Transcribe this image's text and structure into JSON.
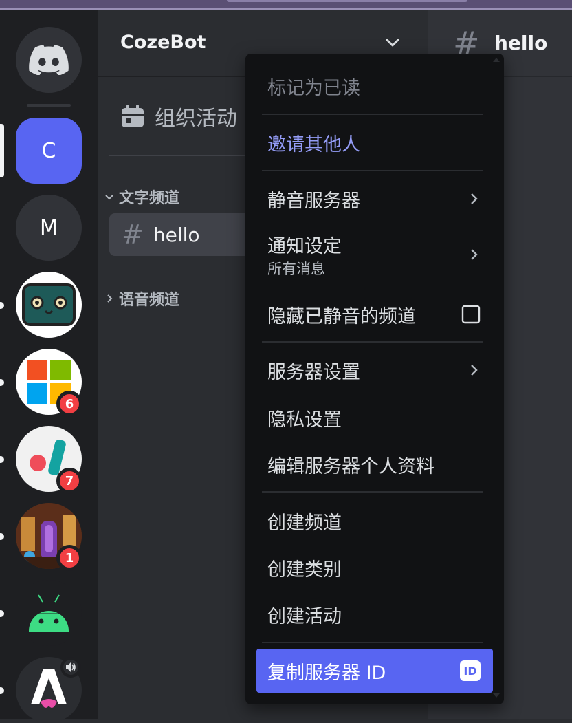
{
  "guild": {
    "name": "CozeBot"
  },
  "sidebar": {
    "events_label": "组织活动",
    "categories": [
      {
        "label": "文字频道",
        "expanded": true
      },
      {
        "label": "语音频道",
        "expanded": false
      }
    ],
    "channel": {
      "hash": "#",
      "name": "hello"
    }
  },
  "chat": {
    "hash": "#",
    "title": "hello"
  },
  "servers": [
    {
      "letter": "C",
      "color": "#5865f2",
      "selected": true
    },
    {
      "letter": "M",
      "color": "#313338"
    },
    {
      "badge": ""
    },
    {
      "badge": "6"
    },
    {
      "badge": "7"
    },
    {
      "badge": "1"
    },
    {
      "badge": ""
    },
    {
      "badge": ""
    }
  ],
  "menu": {
    "mark_read": "标记为已读",
    "invite": "邀请其他人",
    "mute_server": "静音服务器",
    "notification_settings": "通知设定",
    "notification_value": "所有消息",
    "hide_muted": "隐藏已静音的频道",
    "server_settings": "服务器设置",
    "privacy_settings": "隐私设置",
    "edit_profile": "编辑服务器个人资料",
    "create_channel": "创建频道",
    "create_category": "创建类别",
    "create_event": "创建活动",
    "copy_id": "复制服务器 ID",
    "id_badge": "ID"
  },
  "colors": {
    "brand": "#5865f2",
    "brand_text": "#949cf7",
    "danger": "#f23f43",
    "menu_bg": "#111214"
  }
}
